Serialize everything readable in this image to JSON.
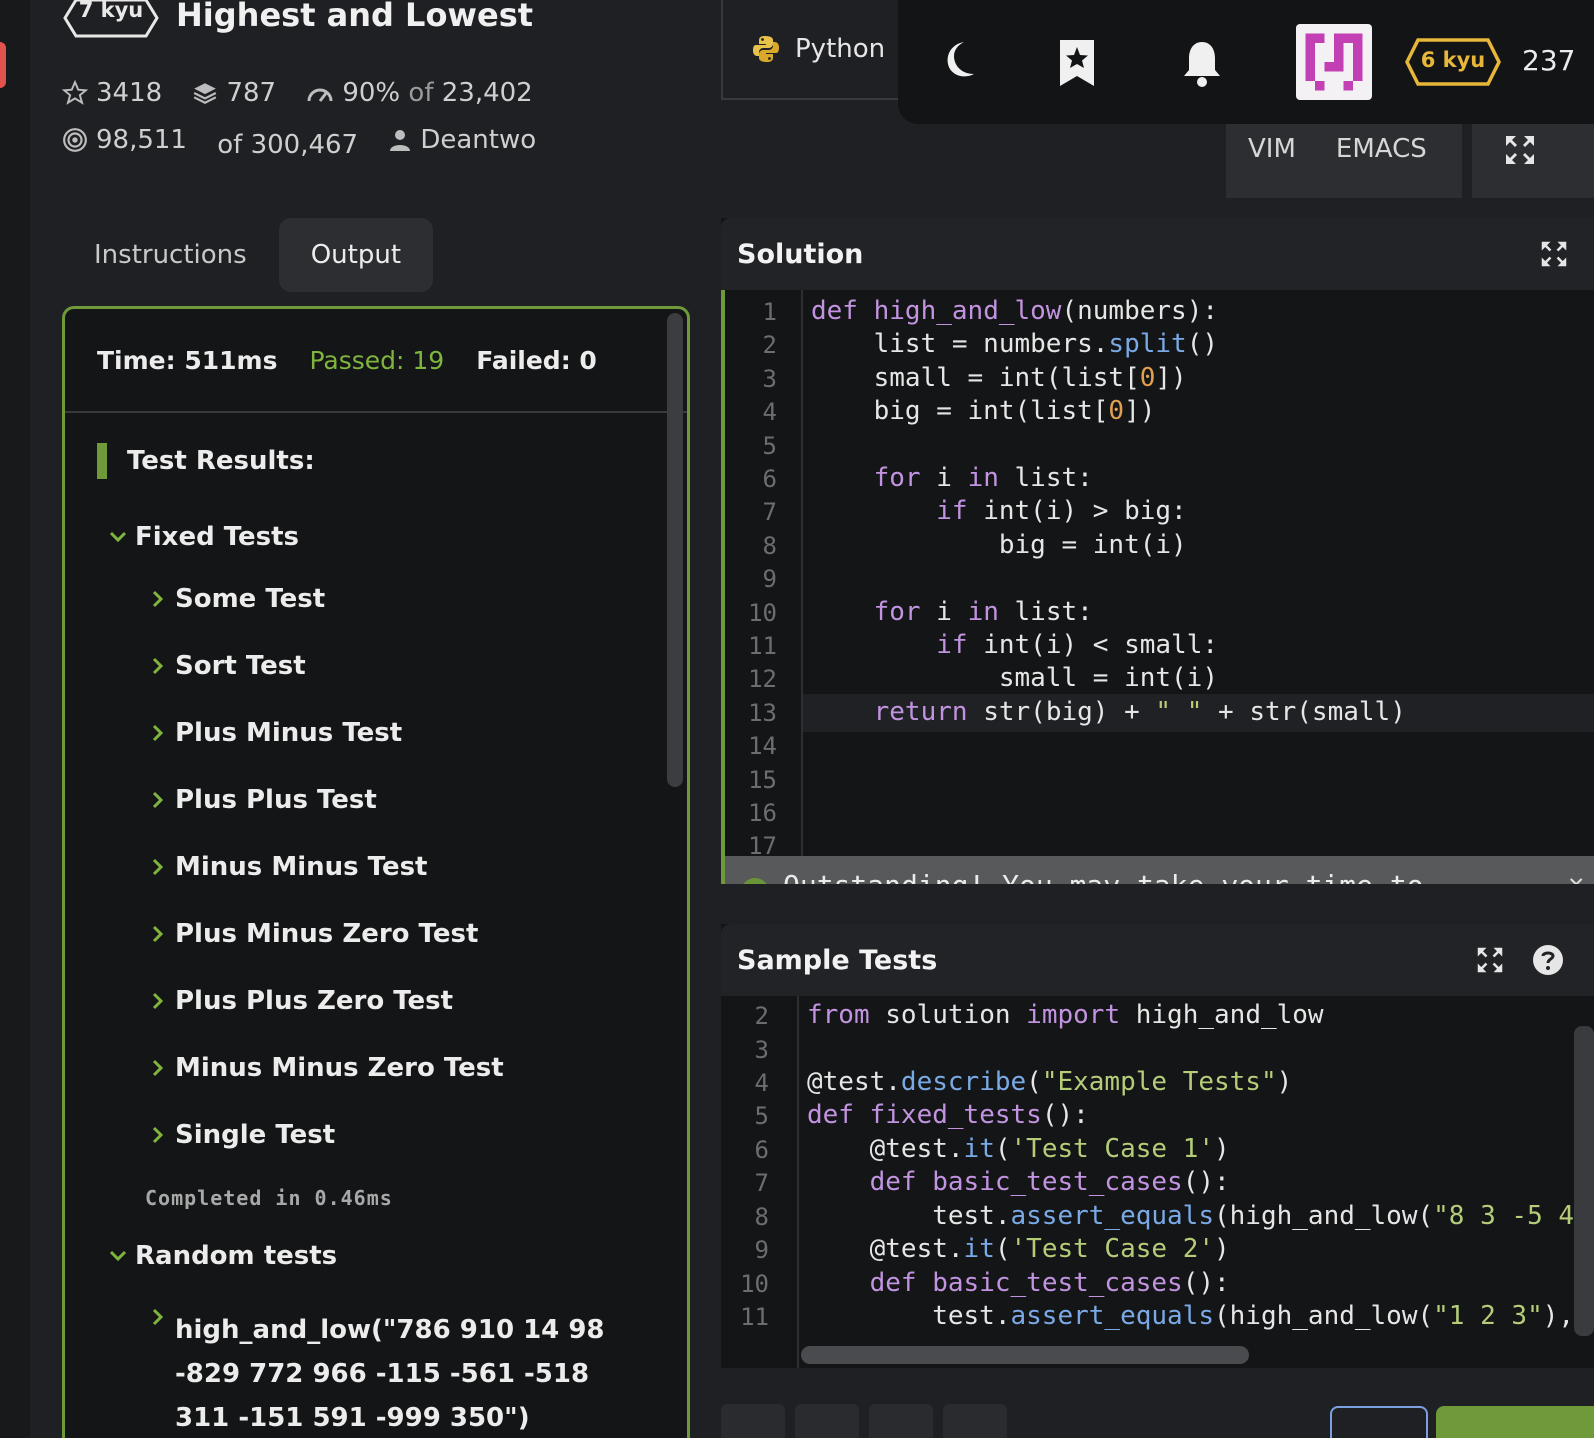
{
  "kata": {
    "kyu": "7 kyu",
    "title": "Highest and Lowest",
    "stars": "3418",
    "collections": "787",
    "satisfaction_pct": "90%",
    "satisfaction_of": "of",
    "satisfaction_votes": "23,402",
    "completed": "98,511",
    "completed_of": "of 300,467",
    "author": "Deantwo"
  },
  "tabs": [
    {
      "label": "Instructions"
    },
    {
      "label": "Output"
    }
  ],
  "output": {
    "time": "Time: 511ms",
    "passed": "Passed: 19",
    "failed": "Failed: 0",
    "results_heading": "Test Results:",
    "fixed_group": "Fixed Tests",
    "fixed_tests": [
      "Some Test",
      "Sort Test",
      "Plus Minus Test",
      "Plus Plus Test",
      "Minus Minus Test",
      "Plus Minus Zero Test",
      "Plus Plus Zero Test",
      "Minus Minus Zero Test",
      "Single Test"
    ],
    "completed_in": "Completed in 0.46ms",
    "random_group": "Random tests",
    "random_first": "high_and_low(\"786 910 14 98 -829 772 966 -115 -561 -518 311 -151 591 -999 350\")"
  },
  "topbar": {
    "language": "Python",
    "rank": "6 kyu",
    "honor": "237"
  },
  "keymap": {
    "vim": "VIM",
    "emacs": "EMACS"
  },
  "solution": {
    "title": "Solution",
    "line_numbers": [
      "1",
      "2",
      "3",
      "4",
      "5",
      "6",
      "7",
      "8",
      "9",
      "10",
      "11",
      "12",
      "13",
      "14",
      "15",
      "16",
      "17"
    ],
    "toast": "Outstanding! You may take your time to refactor/comment your solution. Submit when ready."
  },
  "sample_tests": {
    "title": "Sample Tests",
    "line_numbers": [
      "2",
      "3",
      "4",
      "5",
      "6",
      "7",
      "8",
      "9",
      "10",
      "11"
    ]
  },
  "colors": {
    "accent_green": "#6e9a3a",
    "passed_green": "#7fb53f",
    "rank_yellow": "#e8b73a",
    "keyword_purple": "#c293e0",
    "method_blue": "#7aa9e6",
    "string_green": "#b5cc79",
    "number_orange": "#e0a050"
  }
}
